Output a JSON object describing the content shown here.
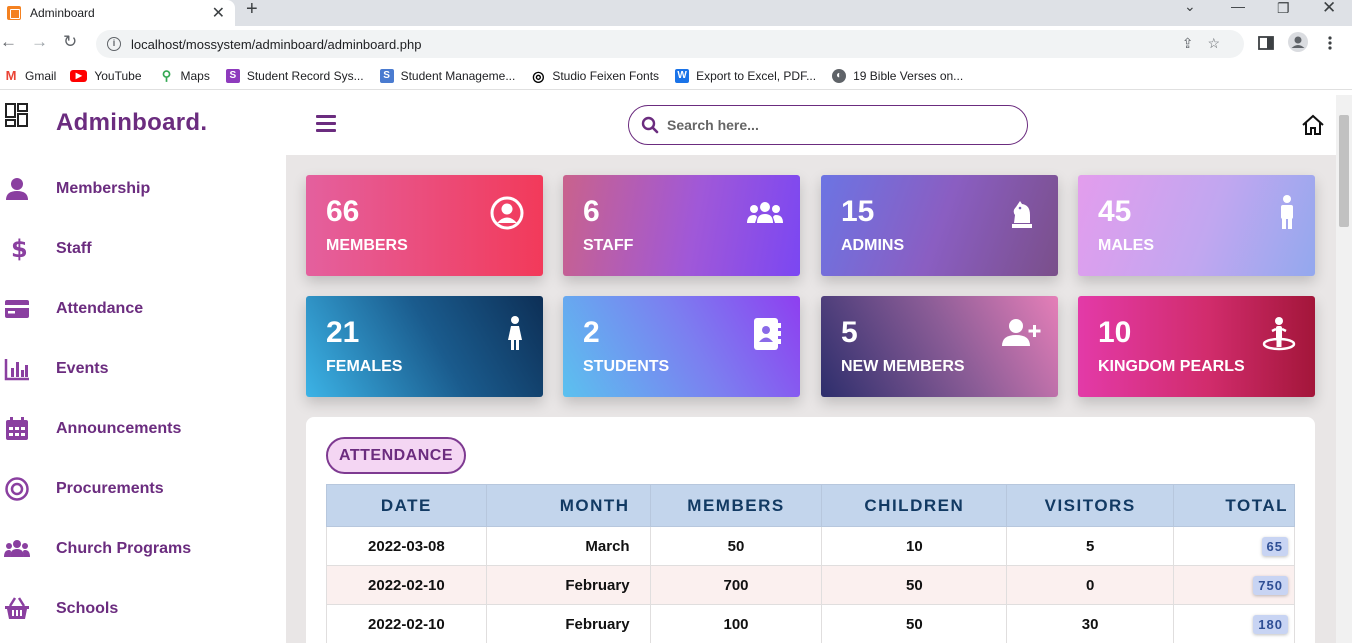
{
  "browser": {
    "tab_title": "Adminboard",
    "url": "localhost/mossystem/adminboard/adminboard.php",
    "bookmarks": [
      {
        "label": "Gmail",
        "icon": "gmail-icon",
        "color": "#ea4335"
      },
      {
        "label": "YouTube",
        "icon": "youtube-icon",
        "color": "#ff0000"
      },
      {
        "label": "Maps",
        "icon": "maps-icon",
        "color": "#34a853"
      },
      {
        "label": "Student Record Sys...",
        "icon": "student-record-icon",
        "color": "#8e3bbd"
      },
      {
        "label": "Student Manageme...",
        "icon": "student-management-icon",
        "color": "#4a7bd0"
      },
      {
        "label": "Studio Feixen Fonts",
        "icon": "feixen-icon",
        "color": "#000000"
      },
      {
        "label": "Export to Excel, PDF...",
        "icon": "word-icon",
        "color": "#1a73e8"
      },
      {
        "label": "19 Bible Verses on...",
        "icon": "globe-icon",
        "color": "#5f6368"
      }
    ]
  },
  "sidebar": {
    "brand": "Adminboard.",
    "items": [
      {
        "label": "Membership",
        "icon": "user-icon"
      },
      {
        "label": "Staff",
        "icon": "dollar-icon"
      },
      {
        "label": "Attendance",
        "icon": "credit-card-icon"
      },
      {
        "label": "Events",
        "icon": "bar-chart-icon"
      },
      {
        "label": "Announcements",
        "icon": "calendar-icon"
      },
      {
        "label": "Procurements",
        "icon": "target-icon"
      },
      {
        "label": "Church Programs",
        "icon": "users-icon"
      },
      {
        "label": "Schools",
        "icon": "basket-icon"
      }
    ]
  },
  "search": {
    "placeholder": "Search here..."
  },
  "cards": [
    {
      "value": "66",
      "label": "MEMBERS",
      "icon": "user-circle-icon"
    },
    {
      "value": "6",
      "label": "STAFF",
      "icon": "users-icon"
    },
    {
      "value": "15",
      "label": "ADMINS",
      "icon": "chess-knight-icon"
    },
    {
      "value": "45",
      "label": "MALES",
      "icon": "male-icon"
    },
    {
      "value": "21",
      "label": "FEMALES",
      "icon": "female-icon"
    },
    {
      "value": "2",
      "label": "STUDENTS",
      "icon": "address-book-icon"
    },
    {
      "value": "5",
      "label": "NEW MEMBERS",
      "icon": "user-plus-icon"
    },
    {
      "value": "10",
      "label": "KINGDOM PEARLS",
      "icon": "person-booth-icon"
    }
  ],
  "attendance": {
    "title": "ATTENDANCE",
    "columns": [
      "DATE",
      "MONTH",
      "MEMBERS",
      "CHILDREN",
      "VISITORS",
      "TOTAL"
    ],
    "rows": [
      [
        "2022-03-08",
        "March",
        "50",
        "10",
        "5",
        "65"
      ],
      [
        "2022-02-10",
        "February",
        "700",
        "50",
        "0",
        "750"
      ],
      [
        "2022-02-10",
        "February",
        "100",
        "50",
        "30",
        "180"
      ]
    ]
  }
}
